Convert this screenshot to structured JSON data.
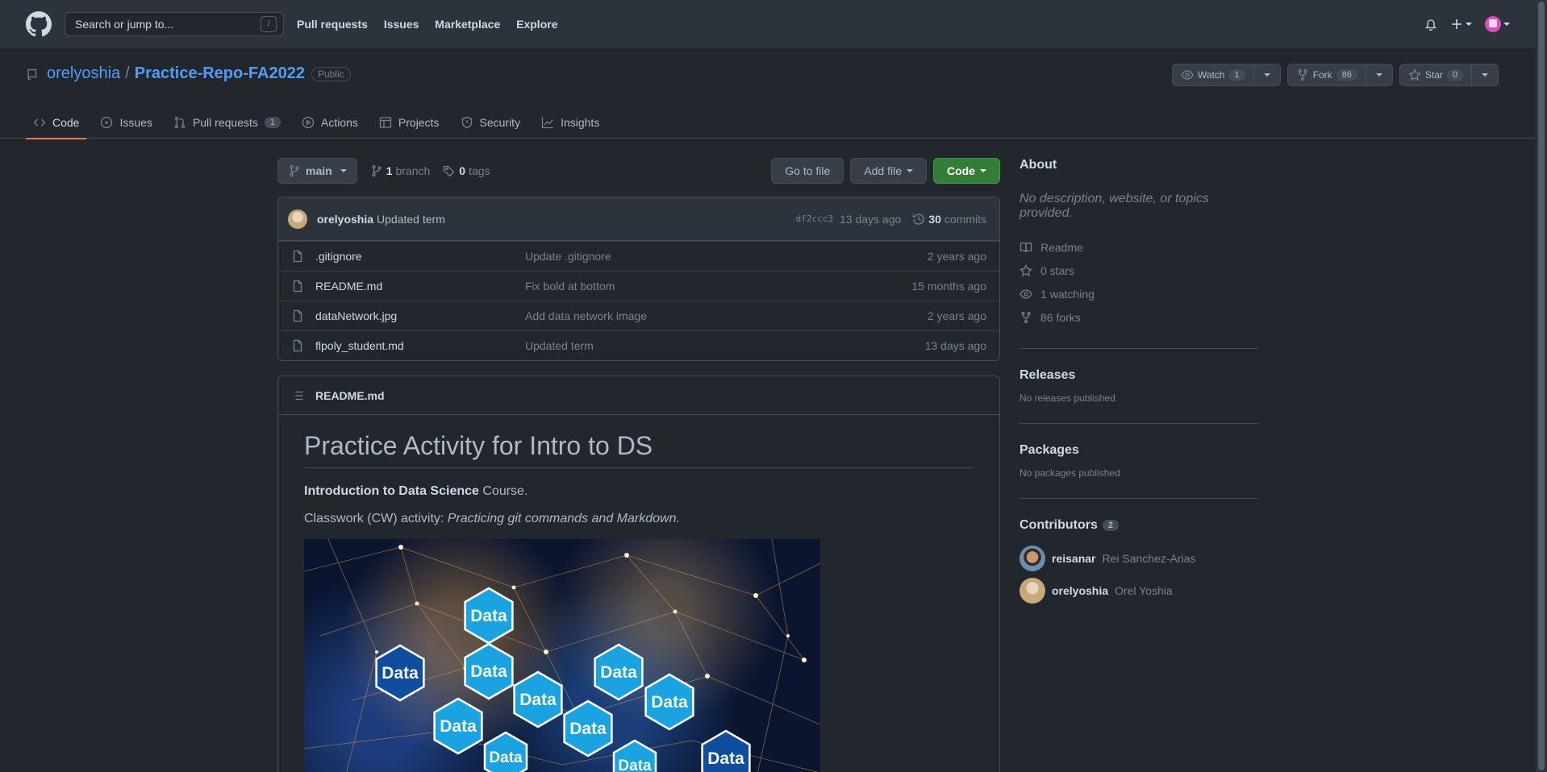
{
  "header": {
    "search_placeholder": "Search or jump to...",
    "search_key": "/",
    "nav": [
      "Pull requests",
      "Issues",
      "Marketplace",
      "Explore"
    ]
  },
  "repo": {
    "owner": "orelyoshia",
    "separator": "/",
    "name": "Practice-Repo-FA2022",
    "visibility": "Public",
    "watch_label": "Watch",
    "watch_count": "1",
    "fork_label": "Fork",
    "fork_count": "86",
    "star_label": "Star",
    "star_count": "0"
  },
  "tabs": [
    {
      "label": "Code",
      "active": true
    },
    {
      "label": "Issues"
    },
    {
      "label": "Pull requests",
      "count": "1"
    },
    {
      "label": "Actions"
    },
    {
      "label": "Projects"
    },
    {
      "label": "Security"
    },
    {
      "label": "Insights"
    }
  ],
  "branch_bar": {
    "branch": "main",
    "branch_count": "1",
    "branch_label": "branch",
    "tag_count": "0",
    "tag_label": "tags",
    "go_to_file": "Go to file",
    "add_file": "Add file",
    "code": "Code"
  },
  "latest_commit": {
    "author": "orelyoshia",
    "message": "Updated term",
    "sha": "df2ccc3",
    "age": "13 days ago",
    "commit_count": "30",
    "commit_label": "commits"
  },
  "files": [
    {
      "name": ".gitignore",
      "message": "Update .gitignore",
      "age": "2 years ago"
    },
    {
      "name": "README.md",
      "message": "Fix bold at bottom",
      "age": "15 months ago"
    },
    {
      "name": "dataNetwork.jpg",
      "message": "Add data network image",
      "age": "2 years ago"
    },
    {
      "name": "flpoly_student.md",
      "message": "Updated term",
      "age": "13 days ago"
    }
  ],
  "readme": {
    "filename": "README.md",
    "title": "Practice Activity for Intro to DS",
    "p1_bold": "Introduction to Data Science",
    "p1_rest": " Course.",
    "p2_plain": "Classwork (CW) activity: ",
    "p2_italic": "Practicing git commands and Markdown.",
    "hex_label": "Data"
  },
  "about": {
    "title": "About",
    "description": "No description, website, or topics provided.",
    "readme": "Readme",
    "stars": "0 stars",
    "watching": "1 watching",
    "forks": "86 forks"
  },
  "releases": {
    "title": "Releases",
    "empty": "No releases published"
  },
  "packages": {
    "title": "Packages",
    "empty": "No packages published"
  },
  "contributors": {
    "title": "Contributors",
    "count": "2",
    "people": [
      {
        "login": "reisanar",
        "name": "Rei Sanchez-Arias"
      },
      {
        "login": "orelyoshia",
        "name": "Orel Yoshia"
      }
    ]
  }
}
